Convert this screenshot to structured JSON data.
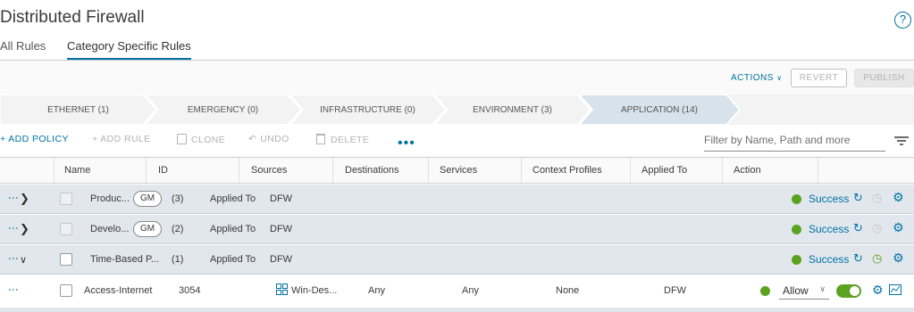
{
  "page": {
    "title": "Distributed Firewall",
    "help_icon": "help-circle-icon"
  },
  "tabs": [
    {
      "label": "All Rules",
      "active": false
    },
    {
      "label": "Category Specific Rules",
      "active": true
    }
  ],
  "actionbar": {
    "actions_label": "ACTIONS",
    "revert_label": "REVERT",
    "publish_label": "PUBLISH"
  },
  "categories": [
    {
      "label": "ETHERNET (1)",
      "active": false
    },
    {
      "label": "EMERGENCY (0)",
      "active": false
    },
    {
      "label": "INFRASTRUCTURE (0)",
      "active": false
    },
    {
      "label": "ENVIRONMENT (3)",
      "active": false
    },
    {
      "label": "APPLICATION (14)",
      "active": true
    }
  ],
  "toolbar": {
    "add_policy": "+ ADD POLICY",
    "add_rule": "+ ADD RULE",
    "clone": "CLONE",
    "undo": "UNDO",
    "delete": "DELETE",
    "more": "•••",
    "filter_placeholder": "Filter by Name, Path and more"
  },
  "columns": [
    "Name",
    "ID",
    "Sources",
    "Destinations",
    "Services",
    "Context Profiles",
    "Applied To",
    "Action"
  ],
  "policies": [
    {
      "name": "Produc...",
      "badge": "GM",
      "count": "(3)",
      "applied_label": "Applied To",
      "applied_value": "DFW",
      "status": "Success",
      "expanded": false
    },
    {
      "name": "Develo...",
      "badge": "GM",
      "count": "(2)",
      "applied_label": "Applied To",
      "applied_value": "DFW",
      "status": "Success",
      "expanded": false
    },
    {
      "name": "Time-Based P...",
      "badge": "",
      "count": "(1)",
      "applied_label": "Applied To",
      "applied_value": "DFW",
      "status": "Success",
      "expanded": true
    }
  ],
  "rule": {
    "name": "Access-Internet",
    "id": "3054",
    "sources": "Win-Des...",
    "destinations": "Any",
    "services": "Any",
    "context_profiles": "None",
    "applied_to": "DFW",
    "action": "Allow",
    "enabled": true
  },
  "colors": {
    "accent": "#0072a3",
    "success": "#5aa220",
    "policy_row_bg": "#e1e7ec"
  }
}
